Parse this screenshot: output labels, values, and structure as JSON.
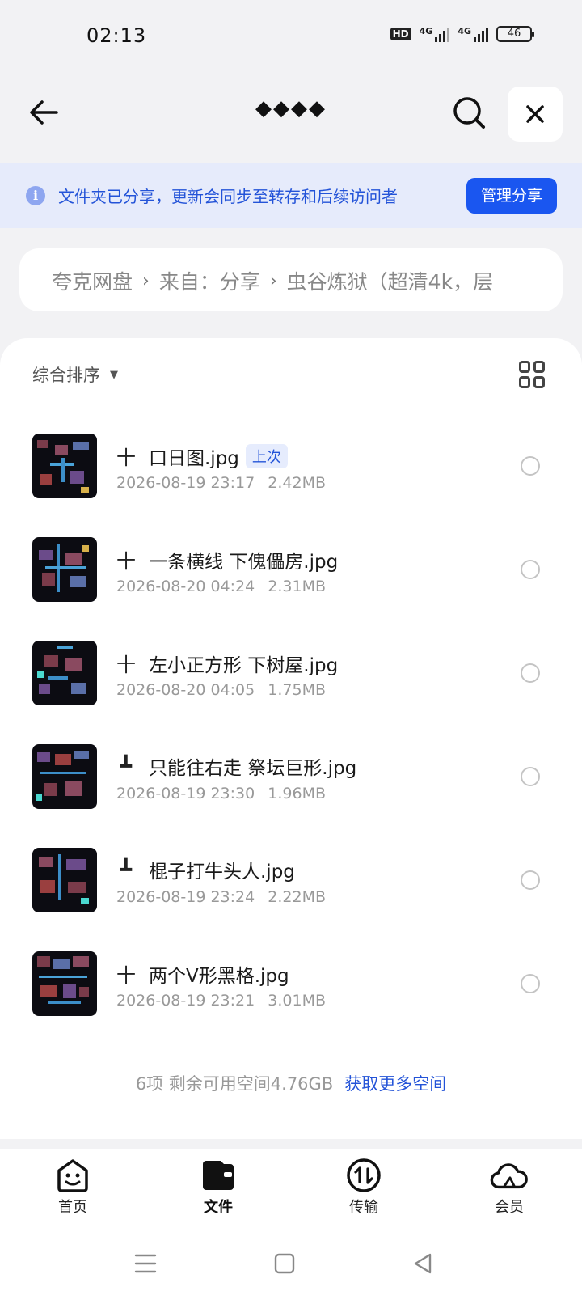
{
  "status_bar": {
    "time": "02:13",
    "hd_badge": "HD",
    "signal_1_label": "4G",
    "signal_2_label": "4G",
    "battery": "46"
  },
  "topnav": {
    "title": "◆◆◆◆",
    "icons": [
      "arrow-left-icon",
      "search-icon",
      "close-icon"
    ]
  },
  "share_banner": {
    "icon": "info-icon",
    "info_glyph": "i",
    "text": "文件夹已分享，更新会同步至转存和后续访问者",
    "manage_label": "管理分享",
    "colors": {
      "bg": "#e6ebfb",
      "text": "#2353d8",
      "button": "#1a56f0"
    }
  },
  "breadcrumb": {
    "items": [
      "夸克网盘",
      "来自：分享",
      "虫谷炼狱（超清4k，层"
    ],
    "separator": "›"
  },
  "sort": {
    "label": "综合排序",
    "caret": "▼",
    "view_toggle_icon": "grid-view-icon"
  },
  "files": [
    {
      "glyph": "十",
      "name": "口日图.jpg",
      "date": "2026-08-19 23:17",
      "size": "2.42MB",
      "tag": "上次"
    },
    {
      "glyph": "十",
      "name": "一条横线 下傀儡房.jpg",
      "date": "2026-08-20 04:24",
      "size": "2.31MB",
      "tag": ""
    },
    {
      "glyph": "十",
      "name": "左小正方形 下树屋.jpg",
      "date": "2026-08-20 04:05",
      "size": "1.75MB",
      "tag": ""
    },
    {
      "glyph": "┻",
      "name": "只能往右走 祭坛巨形.jpg",
      "date": "2026-08-19 23:30",
      "size": "1.96MB",
      "tag": ""
    },
    {
      "glyph": "┻",
      "name": "棍子打牛头人.jpg",
      "date": "2026-08-19 23:24",
      "size": "2.22MB",
      "tag": ""
    },
    {
      "glyph": "十",
      "name": "两个V形黑格.jpg",
      "date": "2026-08-19 23:21",
      "size": "3.01MB",
      "tag": ""
    }
  ],
  "footer": {
    "summary": "6项 剩余可用空间4.76GB",
    "more_space": "获取更多空间"
  },
  "bottom_nav": [
    {
      "label": "首页",
      "icon": "home-face-icon"
    },
    {
      "label": "文件",
      "icon": "wallet-folder-icon",
      "active": true
    },
    {
      "label": "传输",
      "icon": "transfer-icon"
    },
    {
      "label": "会员",
      "icon": "cloud-icon"
    }
  ],
  "system_nav": [
    "menu-icon",
    "home-square-icon",
    "back-triangle-icon"
  ]
}
